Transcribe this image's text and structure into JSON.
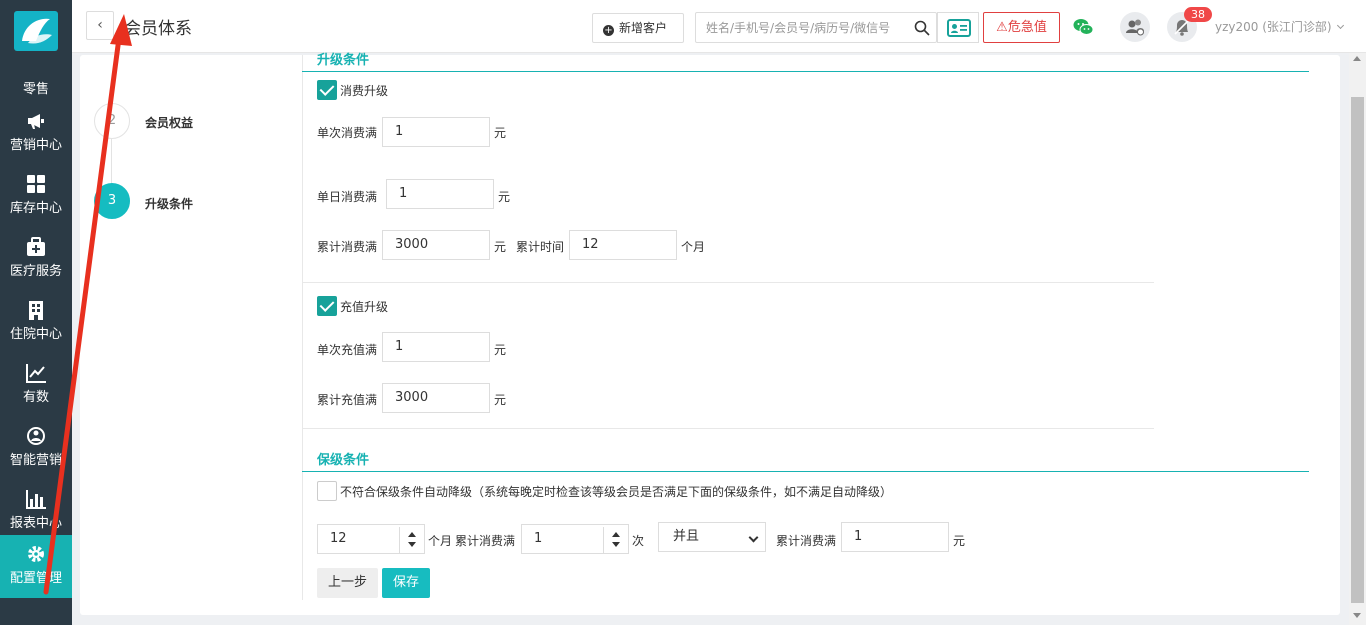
{
  "sidebar": {
    "items": [
      {
        "label": "零售",
        "icon": "retail-icon"
      },
      {
        "label": "营销中心",
        "icon": "megaphone-icon"
      },
      {
        "label": "库存中心",
        "icon": "grid-icon"
      },
      {
        "label": "医疗服务",
        "icon": "medical-kit-icon"
      },
      {
        "label": "住院中心",
        "icon": "building-icon"
      },
      {
        "label": "有数",
        "icon": "line-chart-icon"
      },
      {
        "label": "智能营销",
        "icon": "smart-marketing-icon"
      },
      {
        "label": "报表中心",
        "icon": "bar-chart-icon"
      },
      {
        "label": "配置管理",
        "icon": "gear-icon"
      }
    ],
    "active_color": "#17b2b2"
  },
  "header": {
    "back_symbol": "‹",
    "title": "会员体系",
    "add_customer": "新增客户",
    "search_placeholder": "姓名/手机号/会员号/病历号/微信号",
    "danger_label": "危急值",
    "notification_count": "38",
    "user": "yzy200 (张江门诊部)"
  },
  "steps": [
    {
      "number": "2",
      "label": "会员权益"
    },
    {
      "number": "3",
      "label": "升级条件"
    }
  ],
  "upgrade": {
    "section_title": "升级条件",
    "consume": {
      "checkbox_label": "消费升级",
      "single_label": "单次消费满",
      "single_value": "1",
      "daily_label": "单日消费满",
      "daily_value": "1",
      "total_label": "累计消费满",
      "total_value": "3000",
      "period_label": "累计时间",
      "period_value": "12",
      "month_unit": "个月"
    },
    "recharge": {
      "checkbox_label": "充值升级",
      "single_label": "单次充值满",
      "single_value": "1",
      "total_label": "累计充值满",
      "total_value": "3000"
    },
    "yuan_unit": "元"
  },
  "keep": {
    "section_title": "保级条件",
    "auto_downgrade_label": "不符合保级条件自动降级（系统每晚定时检查该等级会员是否满足下面的保级条件，如不满足自动降级）",
    "months_value": "12",
    "months_unit": "个月",
    "consume_label": "累计消费满",
    "times_value": "1",
    "times_unit": "次",
    "logic_value": "并且",
    "consume_label_2": "累计消费满",
    "amount_value": "1",
    "yuan_unit": "元"
  },
  "buttons": {
    "prev": "上一步",
    "save": "保存"
  }
}
